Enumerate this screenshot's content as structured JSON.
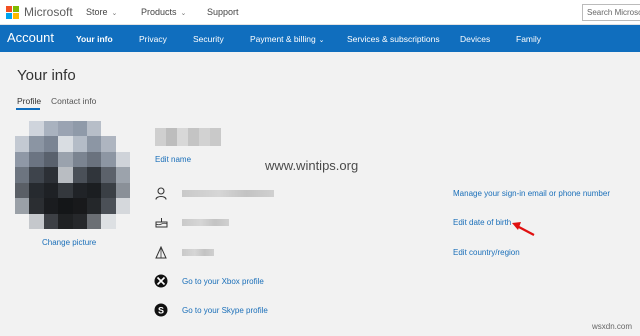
{
  "header": {
    "brand": "Microsoft",
    "nav": [
      {
        "label": "Store",
        "has_dropdown": true
      },
      {
        "label": "Products",
        "has_dropdown": true
      },
      {
        "label": "Support",
        "has_dropdown": false
      }
    ],
    "search_placeholder": "Search Microso",
    "logo_colors": [
      "#f25022",
      "#7fba00",
      "#00a4ef",
      "#ffb900"
    ]
  },
  "account_nav": {
    "title": "Account",
    "background": "#106ebe",
    "items": [
      {
        "label": "Your info",
        "active": true
      },
      {
        "label": "Privacy",
        "active": false
      },
      {
        "label": "Security",
        "active": false
      },
      {
        "label": "Payment & billing",
        "active": false,
        "has_dropdown": true
      },
      {
        "label": "Services & subscriptions",
        "active": false
      },
      {
        "label": "Devices",
        "active": false
      },
      {
        "label": "Family",
        "active": false
      }
    ]
  },
  "page": {
    "title": "Your info",
    "subtabs": [
      {
        "label": "Profile",
        "active": true
      },
      {
        "label": "Contact info",
        "active": false
      }
    ],
    "change_picture": "Change picture",
    "edit_name": "Edit name",
    "xbox_link": "Go to your Xbox profile",
    "skype_link": "Go to your Skype profile",
    "right_links": {
      "manage_signin": "Manage your sign-in email or phone number",
      "edit_dob": "Edit date of birth",
      "edit_country": "Edit country/region"
    },
    "icons": [
      "person-icon",
      "cake-icon",
      "region-icon",
      "xbox-icon",
      "skype-icon"
    ]
  },
  "watermark": "www.wintips.org",
  "footer_watermark": "wsxdn.com"
}
